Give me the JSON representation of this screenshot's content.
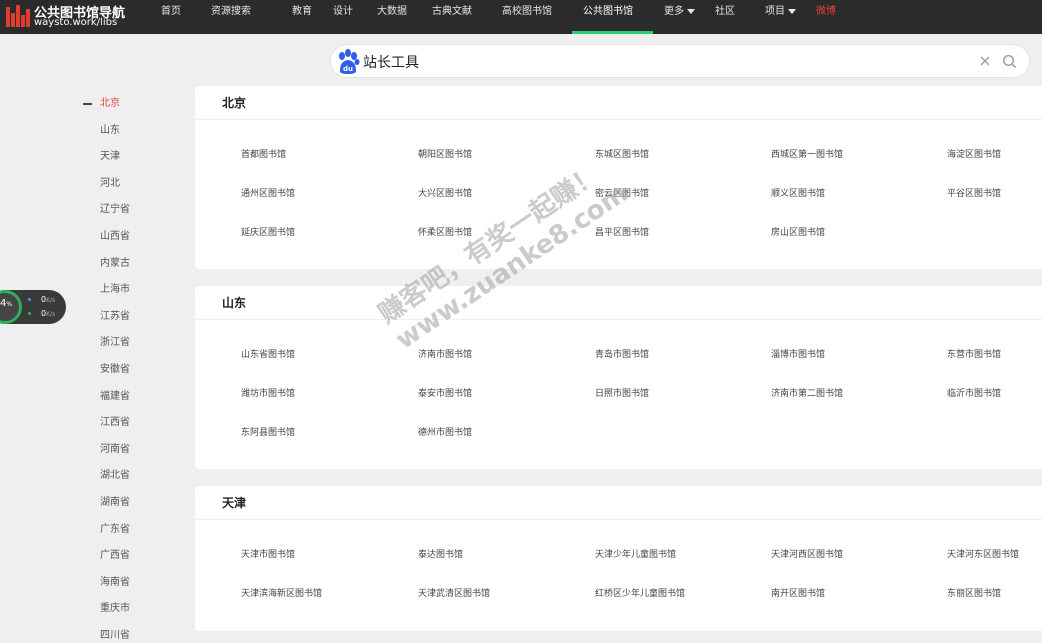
{
  "brand": {
    "title": "公共图书馆导航",
    "url": "waysto.work/libs",
    "accent": "#e03c2f"
  },
  "nav": {
    "items": [
      {
        "label": "首页",
        "state": "normal"
      },
      {
        "label": "资源搜索",
        "state": "normal"
      },
      {
        "label": "教育",
        "state": "normal"
      },
      {
        "label": "设计",
        "state": "normal"
      },
      {
        "label": "大数据",
        "state": "normal"
      },
      {
        "label": "古典文献",
        "state": "normal"
      },
      {
        "label": "高校图书馆",
        "state": "normal"
      },
      {
        "label": "公共图书馆",
        "state": "active"
      },
      {
        "label": "更多",
        "state": "dropdown"
      },
      {
        "label": "社区",
        "state": "normal"
      },
      {
        "label": "项目",
        "state": "dropdown"
      },
      {
        "label": "微博",
        "state": "highlight"
      }
    ],
    "active_color": "#2ecc71",
    "highlight_color": "#e8403a"
  },
  "search": {
    "value": "站长工具",
    "icon": "baidu-logo"
  },
  "provinces": {
    "items": [
      "北京",
      "山东",
      "天津",
      "河北",
      "辽宁省",
      "山西省",
      "内蒙古",
      "上海市",
      "江苏省",
      "浙江省",
      "安徽省",
      "福建省",
      "江西省",
      "河南省",
      "湖北省",
      "湖南省",
      "广东省",
      "广西省",
      "海南省",
      "重庆市",
      "四川省"
    ],
    "active": "北京",
    "active_color": "#e8453c"
  },
  "speed_widget": {
    "percent": "4",
    "percent_unit": "%",
    "upload": "0",
    "download": "0",
    "unit": "K/s"
  },
  "sections": [
    {
      "title": "北京",
      "libraries": [
        "首都图书馆",
        "朝阳区图书馆",
        "东城区图书馆",
        "西城区第一图书馆",
        "海淀区图书馆",
        "通州区图书馆",
        "大兴区图书馆",
        "密云区图书馆",
        "顺义区图书馆",
        "平谷区图书馆",
        "延庆区图书馆",
        "怀柔区图书馆",
        "昌平区图书馆",
        "房山区图书馆"
      ]
    },
    {
      "title": "山东",
      "libraries": [
        "山东省图书馆",
        "济南市图书馆",
        "青岛市图书馆",
        "淄博市图书馆",
        "东营市图书馆",
        "潍坊市图书馆",
        "泰安市图书馆",
        "日照市图书馆",
        "济南市第二图书馆",
        "临沂市图书馆",
        "东阿县图书馆",
        "德州市图书馆"
      ]
    },
    {
      "title": "天津",
      "libraries": [
        "天津市图书馆",
        "泰达图书馆",
        "天津少年儿童图书馆",
        "天津河西区图书馆",
        "天津河东区图书馆",
        "天津滨海新区图书馆",
        "天津武清区图书馆",
        "红桥区少年儿童图书馆",
        "南开区图书馆",
        "东丽区图书馆"
      ]
    }
  ],
  "watermark": {
    "line1": "赚客吧，有奖一起赚！",
    "line2": "www.zuanke8.com"
  }
}
